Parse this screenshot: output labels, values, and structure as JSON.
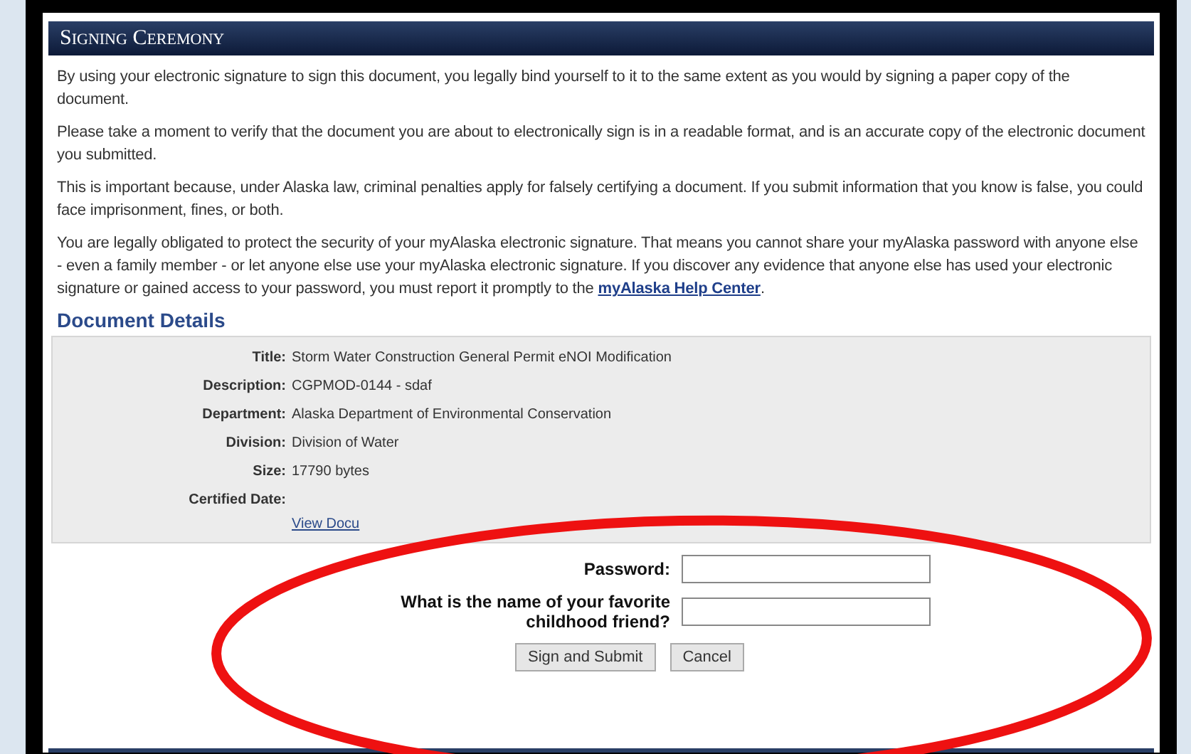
{
  "header": {
    "title": "Signing Ceremony"
  },
  "paragraphs": [
    "By using your electronic signature to sign this document, you legally bind yourself to it to the same extent as you would by signing a paper copy of the document.",
    "Please take a moment to verify that the document you are about to electronically sign is in a readable format, and is an accurate copy of the electronic document you submitted.",
    "This is important because, under Alaska law, criminal penalties apply for falsely certifying a document. If you submit information that you know is false, you could face imprisonment, fines, or both."
  ],
  "notice": {
    "text": "You are legally obligated to protect the security of your myAlaska electronic signature. That means you cannot share your myAlaska password with anyone else - even a family member - or let anyone else use your myAlaska electronic signature. If you discover any evidence that anyone else has used your electronic signature or gained access to your password, you must report it promptly to the",
    "link": "myAlaska Help Center",
    "end": "."
  },
  "details": {
    "heading": "Document Details",
    "rows": [
      {
        "label": "Title:",
        "value": "Storm Water Construction General Permit eNOI Modification"
      },
      {
        "label": "Description:",
        "value": "CGPMOD-0144 - sdaf"
      },
      {
        "label": "Department:",
        "value": "Alaska Department of Environmental Conservation"
      },
      {
        "label": "Division:",
        "value": "Division of Water"
      },
      {
        "label": "Size:",
        "value": "17790 bytes"
      },
      {
        "label": "Certified Date:",
        "value": ""
      }
    ],
    "link": "View Docu"
  },
  "form": {
    "fields": [
      {
        "label": "Password:"
      },
      {
        "label": "What is the name of your favorite childhood friend?"
      }
    ],
    "buttons": [
      "Sign and Submit",
      "Cancel"
    ]
  }
}
